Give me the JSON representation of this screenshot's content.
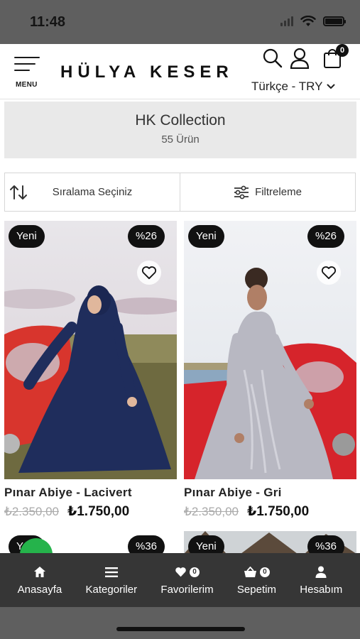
{
  "status_bar": {
    "time": "11:48"
  },
  "header": {
    "menu_label": "MENU",
    "logo": "HÜLYA KESER",
    "cart_count": "0",
    "language_currency": "Türkçe - TRY",
    "icons": [
      "search-icon",
      "user-icon",
      "cart-icon",
      "chevron-down-icon"
    ]
  },
  "collection": {
    "title": "HK Collection",
    "count": "55 Ürün"
  },
  "toolbar": {
    "sort_label": "Sıralama Seçiniz",
    "filter_label": "Filtreleme"
  },
  "products": [
    {
      "badge_new": "Yeni",
      "badge_discount": "%26",
      "name": "Pınar Abiye - Lacivert",
      "old_price": "₺2.350,00",
      "new_price": "₺1.750,00",
      "dress_color": "#1f2d5c"
    },
    {
      "badge_new": "Yeni",
      "badge_discount": "%26",
      "name": "Pınar Abiye - Gri",
      "old_price": "₺2.350,00",
      "new_price": "₺1.750,00",
      "dress_color": "#b8b8c2"
    }
  ],
  "next_row": [
    {
      "badge_new": "Yeni",
      "badge_discount": "%36"
    },
    {
      "badge_new": "Yeni",
      "badge_discount": "%36"
    }
  ],
  "bottom_nav": {
    "items": [
      {
        "label": "Anasayfa",
        "icon": "home-icon"
      },
      {
        "label": "Kategoriler",
        "icon": "list-icon"
      },
      {
        "label": "Favorilerim",
        "icon": "heart-icon",
        "count": "0"
      },
      {
        "label": "Sepetim",
        "icon": "basket-icon",
        "count": "0"
      },
      {
        "label": "Hesabım",
        "icon": "user-icon"
      }
    ]
  },
  "colors": {
    "nav_background": "#363636",
    "badge": "#111111",
    "status_bar": "#5f5f5f"
  }
}
